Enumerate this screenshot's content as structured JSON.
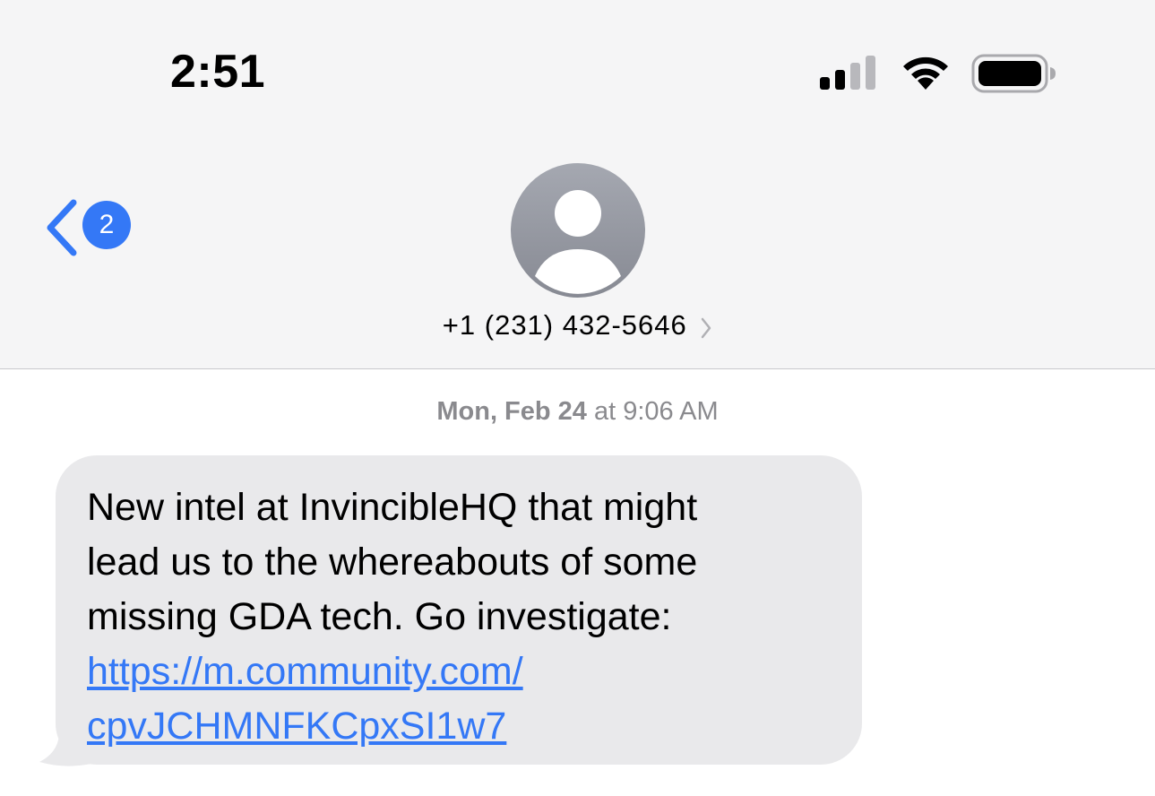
{
  "status_bar": {
    "time": "2:51",
    "signal_icon": "cellular-signal-icon",
    "wifi_icon": "wifi-icon",
    "battery_icon": "battery-icon"
  },
  "nav": {
    "back_icon": "chevron-left-icon",
    "unread_count": "2",
    "contact_name": "+1 (231) 432-5646",
    "contact_chevron_icon": "chevron-right-icon",
    "avatar_icon": "person-icon"
  },
  "conversation": {
    "timestamp_day": "Mon, Feb 24",
    "timestamp_rest": " at 9:06 AM",
    "messages": [
      {
        "direction": "incoming",
        "text": "New intel at InvincibleHQ that might\nlead us to the whereabouts of some\nmissing GDA tech. Go investigate:",
        "link": "https://m.community.com/\ncpvJCHMNFKCpxSI1w7"
      }
    ]
  },
  "colors": {
    "accent": "#3478f6",
    "bubble": "#e9e9eb",
    "header_bg": "#f5f5f6",
    "timestamp": "#8a8a8e"
  }
}
